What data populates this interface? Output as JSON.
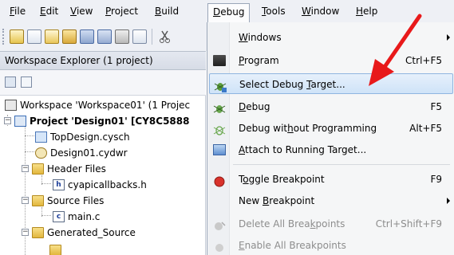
{
  "menubar": {
    "items": [
      {
        "label": "File",
        "u": "F",
        "rest": "ile"
      },
      {
        "label": "Edit",
        "u": "E",
        "rest": "dit"
      },
      {
        "label": "View",
        "u": "V",
        "rest": "iew"
      },
      {
        "label": "Project",
        "u": "P",
        "rest": "roject"
      },
      {
        "label": "Build",
        "u": "B",
        "rest": "uild"
      },
      {
        "label": "Debug",
        "u": "D",
        "rest": "ebug"
      },
      {
        "label": "Tools",
        "u": "T",
        "rest": "ools"
      },
      {
        "label": "Window",
        "u": "W",
        "rest": "indow"
      },
      {
        "label": "Help",
        "u": "H",
        "rest": "elp"
      }
    ]
  },
  "workspace": {
    "header": "Workspace Explorer (1 project)",
    "tree": {
      "workspace": "Workspace 'Workspace01' (1 Projec",
      "project_bold": "Project  'Design01'  [CY8C5888",
      "topdesign": "TopDesign.cysch",
      "design01": "Design01.cydwr",
      "header_files": "Header Files",
      "cyapicallbacks": "cyapicallbacks.h",
      "source_files": "Source Files",
      "mainc": "main.c",
      "generated_source": "Generated_Source"
    },
    "file_h_glyph": "h",
    "file_c_glyph": "c"
  },
  "debug_menu": {
    "items": [
      {
        "pre": "",
        "u": "W",
        "post": "indows",
        "shortcut": ""
      },
      {
        "pre": "",
        "u": "P",
        "post": "rogram",
        "shortcut": "Ctrl+F5"
      },
      {
        "pre": "Select Debug ",
        "u": "T",
        "post": "arget...",
        "shortcut": ""
      },
      {
        "pre": "",
        "u": "D",
        "post": "ebug",
        "shortcut": "F5"
      },
      {
        "pre": "Debug wit",
        "u": "h",
        "post": "out Programming",
        "shortcut": "Alt+F5"
      },
      {
        "pre": "",
        "u": "A",
        "post": "ttach to Running Target...",
        "shortcut": ""
      },
      {
        "pre": "T",
        "u": "o",
        "post": "ggle Breakpoint",
        "shortcut": "F9"
      },
      {
        "pre": "New ",
        "u": "B",
        "post": "reakpoint",
        "shortcut": ""
      },
      {
        "pre": "Delete All Brea",
        "u": "k",
        "post": "points",
        "shortcut": "Ctrl+Shift+F9"
      },
      {
        "pre": "",
        "u": "E",
        "post": "nable All Breakpoints",
        "shortcut": ""
      }
    ]
  },
  "colors": {
    "highlight": "#cfe3f8",
    "arrow": "#e8191a",
    "disabled_text": "#8d8d8d"
  }
}
